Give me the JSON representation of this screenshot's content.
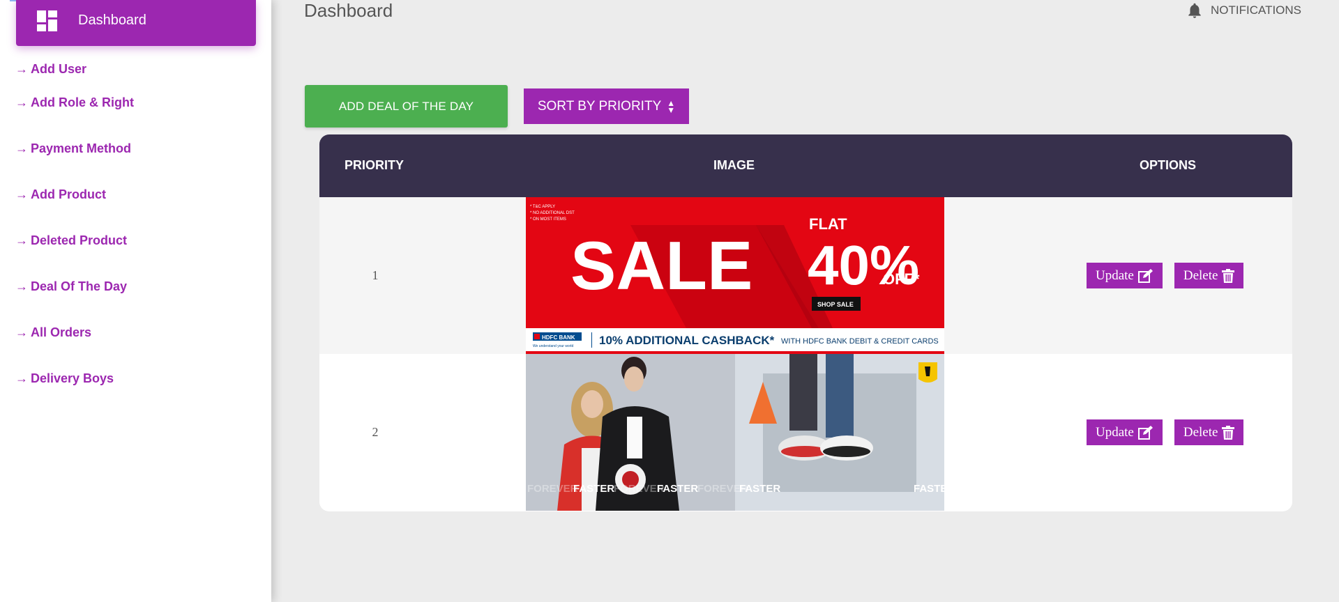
{
  "sidebar": {
    "dashboard_label": "Dashboard",
    "items": [
      {
        "label": "Add User"
      },
      {
        "label": "Add Role & Right"
      },
      {
        "label": "Payment Method"
      },
      {
        "label": "Add Product"
      },
      {
        "label": "Deleted Product"
      },
      {
        "label": "Deal Of The Day"
      },
      {
        "label": "All Orders"
      },
      {
        "label": "Delivery Boys"
      }
    ]
  },
  "header": {
    "title": "Dashboard",
    "notifications_label": "NOTIFICATIONS"
  },
  "toolbar": {
    "add_deal_label": "ADD DEAL OF THE DAY",
    "sort_label": "SORT BY PRIORITY"
  },
  "table": {
    "columns": [
      "PRIORITY",
      "IMAGE",
      "OPTIONS"
    ],
    "rows": [
      {
        "priority": "1",
        "banner": {
          "tc_lines": [
            "* T&C APPLY",
            "* NO ADDITIONAL DST",
            "* ON MOST ITEMS"
          ],
          "headline": "SALE",
          "flat": "FLAT",
          "percent": "40%",
          "off": "OFF*",
          "shop_button": "SHOP SALE",
          "bank_name": "HDFC BANK",
          "bank_tagline": "We understand your world",
          "cashback": "10% ADDITIONAL CASHBACK*",
          "cashback_detail": "WITH HDFC BANK DEBIT & CREDIT CARDS"
        },
        "update_label": "Update",
        "delete_label": "Delete"
      },
      {
        "priority": "2",
        "banner": {
          "strip_text": [
            "FOREVER",
            "FASTER",
            "FOREVER",
            "FASTER",
            "FOREVER",
            "FASTER",
            "FASTER"
          ]
        },
        "update_label": "Update",
        "delete_label": "Delete"
      }
    ]
  },
  "colors": {
    "accent": "#9c27b0",
    "add_button": "#4caf50",
    "table_header": "#37304c",
    "sale_red": "#e30613"
  }
}
